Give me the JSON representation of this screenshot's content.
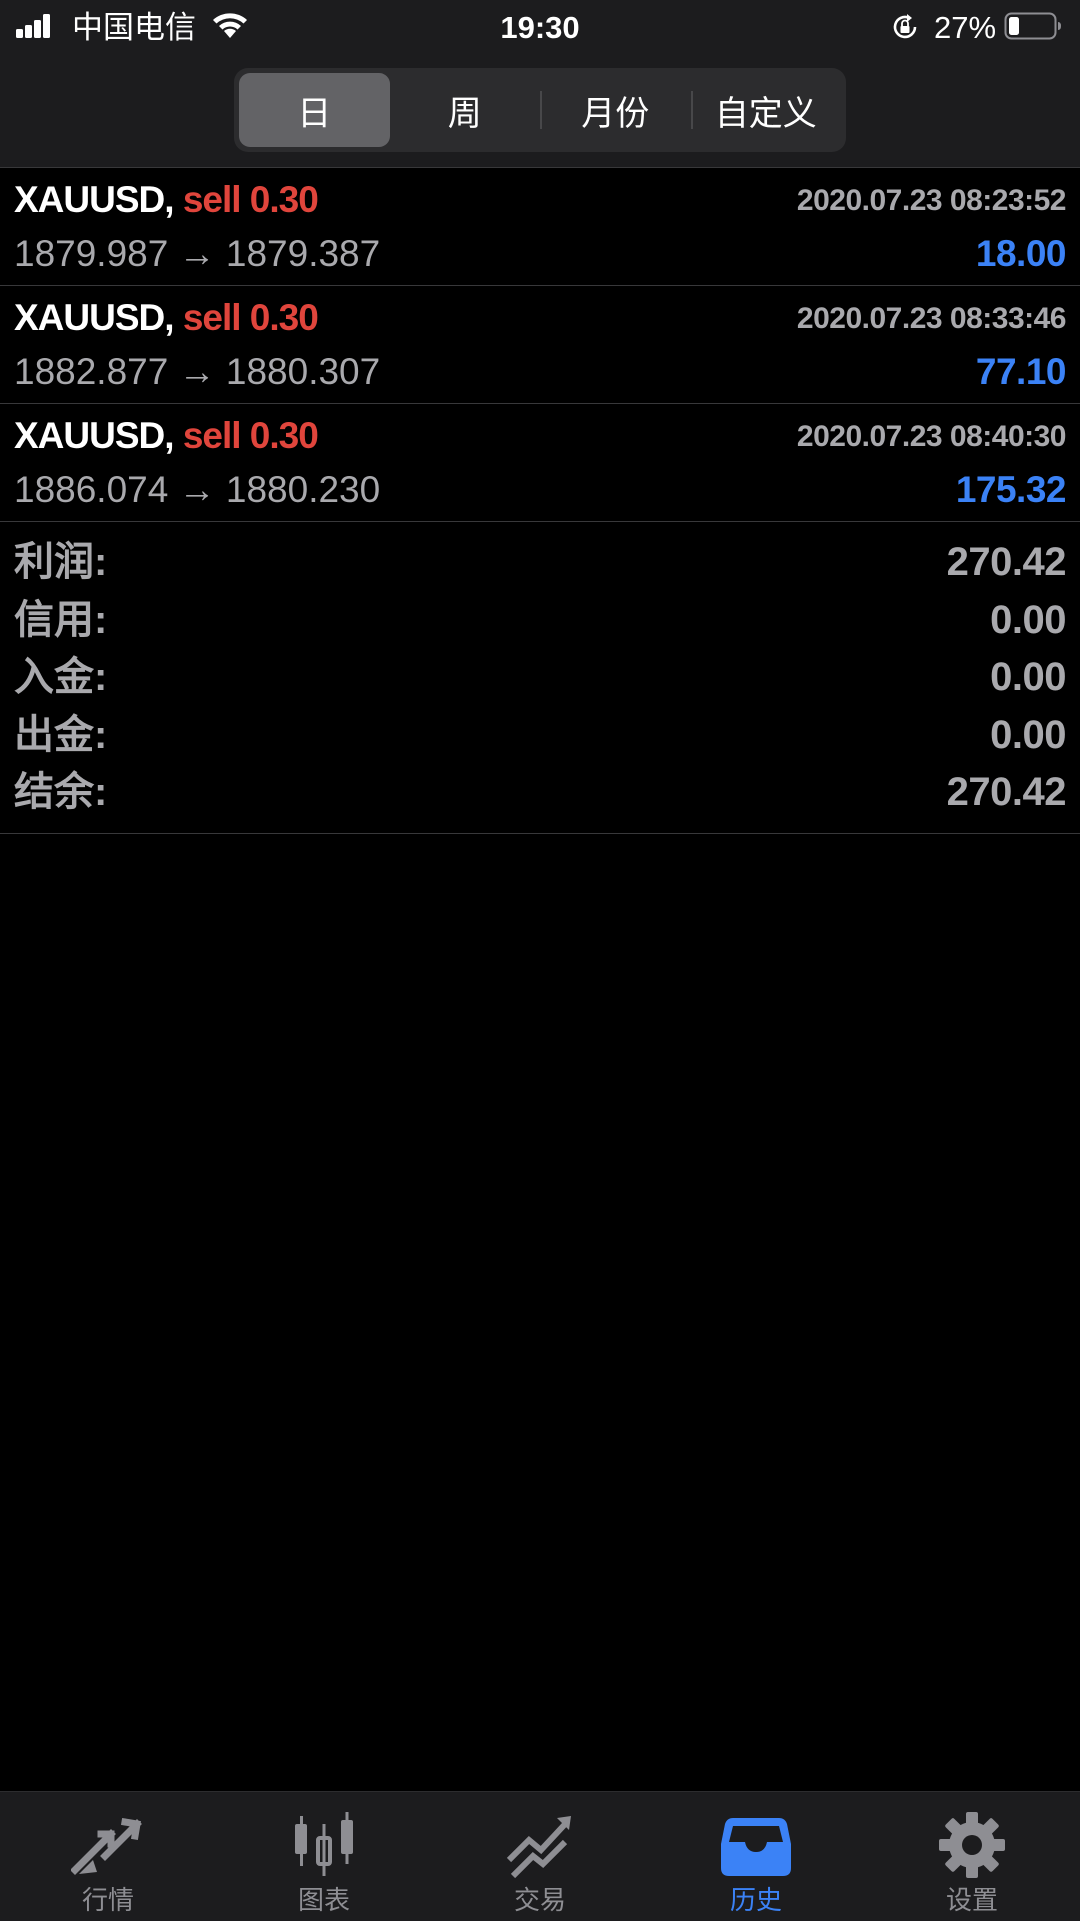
{
  "status_bar": {
    "carrier": "中国电信",
    "time": "19:30",
    "battery": "27%"
  },
  "period_tabs": [
    {
      "label": "日",
      "active": true
    },
    {
      "label": "周",
      "active": false
    },
    {
      "label": "月份",
      "active": false
    },
    {
      "label": "自定义",
      "active": false
    }
  ],
  "deals": [
    {
      "symbol": "XAUUSD,",
      "side": "sell 0.30",
      "time": "2020.07.23 08:23:52",
      "prices": "1879.987 → 1879.387",
      "profit": "18.00"
    },
    {
      "symbol": "XAUUSD,",
      "side": "sell 0.30",
      "time": "2020.07.23 08:33:46",
      "prices": "1882.877 → 1880.307",
      "profit": "77.10"
    },
    {
      "symbol": "XAUUSD,",
      "side": "sell 0.30",
      "time": "2020.07.23 08:40:30",
      "prices": "1886.074 → 1880.230",
      "profit": "175.32"
    }
  ],
  "summary": [
    {
      "label": "利润:",
      "value": "270.42"
    },
    {
      "label": "信用:",
      "value": "0.00"
    },
    {
      "label": "入金:",
      "value": "0.00"
    },
    {
      "label": "出金:",
      "value": "0.00"
    },
    {
      "label": "结余:",
      "value": "270.42"
    }
  ],
  "tab_bar": [
    {
      "label": "行情",
      "icon": "quotes-icon",
      "active": false
    },
    {
      "label": "图表",
      "icon": "chart-icon",
      "active": false
    },
    {
      "label": "交易",
      "icon": "trade-icon",
      "active": false
    },
    {
      "label": "历史",
      "icon": "history-icon",
      "active": true
    },
    {
      "label": "设置",
      "icon": "gear-icon",
      "active": false
    }
  ],
  "colors": {
    "background": "#000000",
    "sell": "#e0453c",
    "profit": "#3b82f6",
    "muted": "#a9a9ad",
    "tab_active": "#3b82f6"
  }
}
